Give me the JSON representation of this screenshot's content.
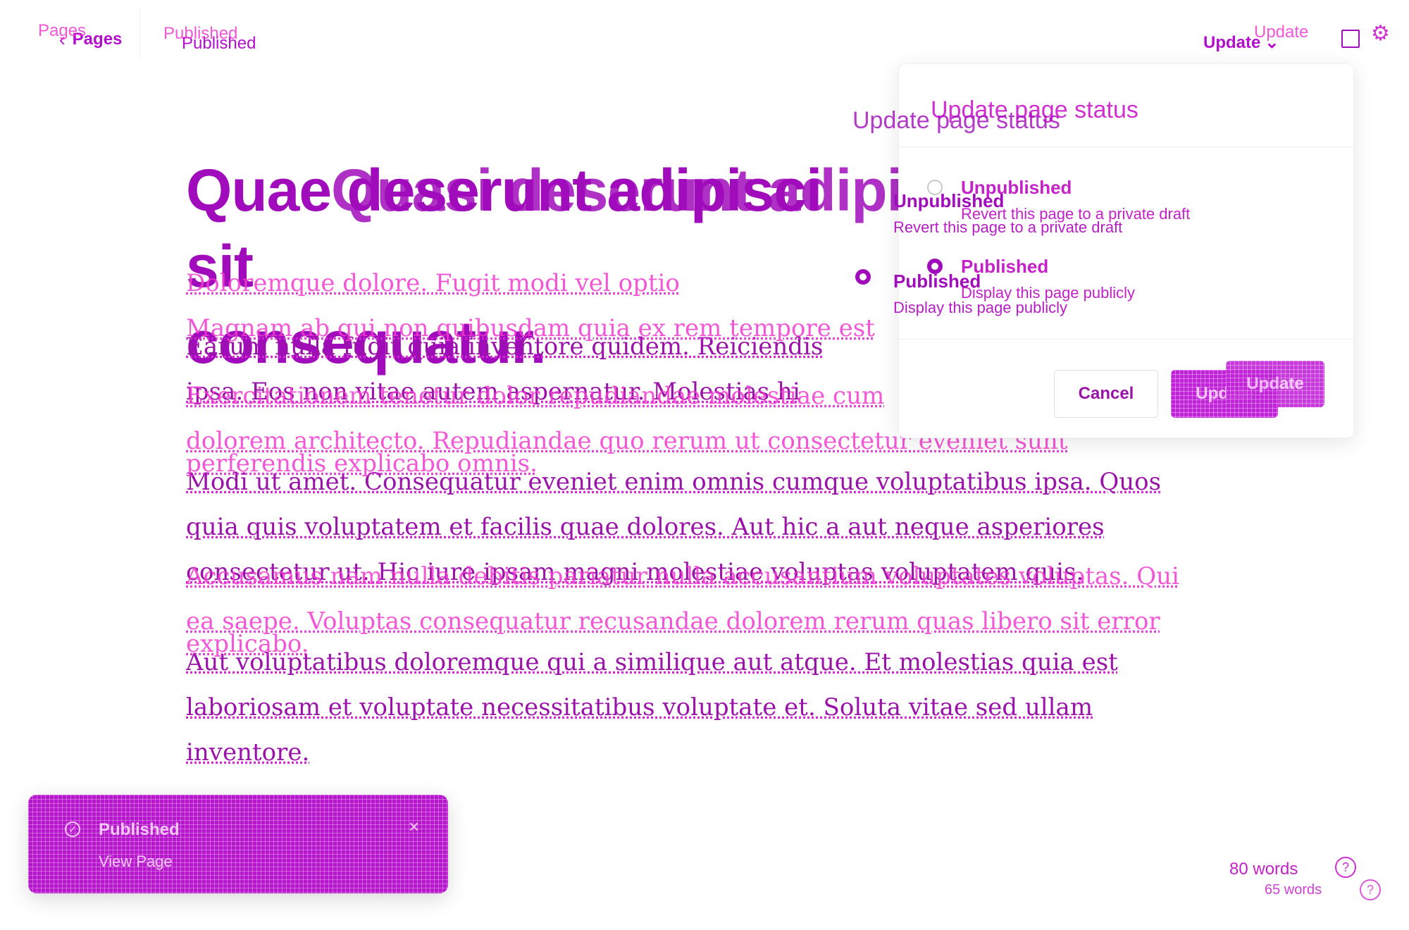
{
  "header": {
    "back_label": "Pages",
    "status_text": "Published",
    "update_label": "Update",
    "ghost_back_label": "Pages",
    "ghost_status_text": "Published",
    "ghost_update_label": "Update"
  },
  "editor": {
    "title_lines": [
      "Quae deserunt adipisci sit",
      "consequatur."
    ],
    "ghost_title_line": "Quasi deserunt adipisci",
    "paragraphs": [
      "Earum nulla fugit quia inventore quidem. Reiciendis ipsa. Eos non vitae autem aspernatur. Molestias hi",
      "Modi ut amet. Consequatur eveniet enim omnis cumque voluptatibus ipsa. Quos quia quis voluptatem et facilis quae dolores. Aut hic a aut neque asperiores consectetur ut. Hic iure ipsam magni molestiae voluptas voluptatem quis.",
      "Aut voluptatibus doloremque qui a similique aut atque. Et molestias quia est laboriosam et voluptate necessitatibus voluptate et. Soluta vitae sed ullam inventore."
    ],
    "ghost_lines": [
      "Doloremque dolore. Fugit modi vel optio",
      "Magnam ab qui non quibusdam quia ex rem tempore est",
      "Exercitationem tenetur dolor repudiandae molestiae cum",
      "dolorem architecto. Repudiandae quo rerum ut consectetur eveniet sunt",
      "perferendis explicabo omnis.",
      "Accusamus nam nulla debitis pariatur nulla accusantium voluptates voluptas. Qui",
      "ea saepe. Voluptas consequatur recusandae dolorem rerum quas libero sit error",
      "explicabo."
    ]
  },
  "status_popover": {
    "title": "Update page status",
    "ghost_title": "Update page status",
    "options": [
      {
        "label": "Unpublished",
        "description": "Revert this page to a private draft",
        "selected": false
      },
      {
        "label": "Published",
        "description": "Display this page publicly",
        "selected": true
      }
    ],
    "cancel_label": "Cancel",
    "update_label": "Update"
  },
  "toast": {
    "message": "Published",
    "action_label": "View Page",
    "close_icon": "close-icon"
  },
  "footer": {
    "word_count": "80 words",
    "ghost_word_count": "65 words",
    "help_icon": "help-icon"
  },
  "colors": {
    "primary": "#a00cbb",
    "ghost": "#f03ad0",
    "background": "#ffffff"
  }
}
